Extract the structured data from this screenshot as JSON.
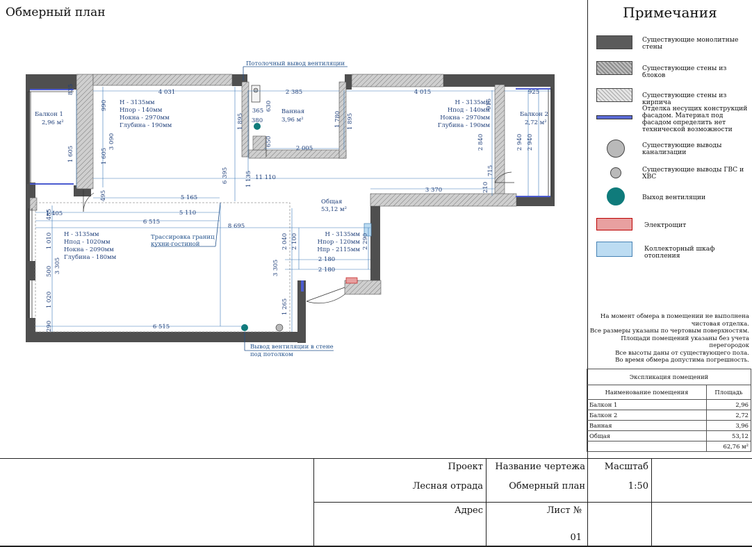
{
  "drawing_title": "Обмерный план",
  "notes": {
    "title": "Примечания",
    "legend": [
      {
        "icon": "monolith-wall-swatch",
        "label": "Существующие монолитные стены",
        "color": "#5b5b5b"
      },
      {
        "icon": "block-wall-swatch",
        "label": "Существующие стены из блоков",
        "color": "#9a9a9a"
      },
      {
        "icon": "brick-wall-swatch",
        "label": "Существующие стены из кирпича",
        "color": "#c8c8c8"
      },
      {
        "icon": "facade-finish-swatch",
        "label": "Отделка несущих конструкций фасадом. Материал под фасадом определить нет технической возможности",
        "color": "#5b6bd6"
      },
      {
        "icon": "sewer-outlet-circle",
        "label": "Существующие выводы канализации",
        "color": "#b9b9b9"
      },
      {
        "icon": "water-outlet-circle",
        "label": "Существующие выводы ГВС и ХВС",
        "color": "#b9b9b9"
      },
      {
        "icon": "ventilation-outlet-circle",
        "label": "Выход вентиляции",
        "color": "#0f7b7b"
      },
      {
        "icon": "electric-panel-swatch",
        "label": "Электрощит",
        "color": "#e8a0a0"
      },
      {
        "icon": "heating-cabinet-swatch",
        "label": "Коллекторный шкаф отопления",
        "color": "#bcdcf2"
      }
    ],
    "remarks": [
      "На момент обмера в помещении не выполнена",
      "чистовая отделка.",
      "Все размеры указаны по чертовым поверхностям.",
      "Площади помещений указаны без учета",
      "перегородок",
      "Все высоты даны от существующего пола.",
      "Во время обмера допустима погрешность."
    ]
  },
  "explication": {
    "title": "Экспликация помещений",
    "headers": [
      "Наименование помещения",
      "Площадь"
    ],
    "rows": [
      {
        "name": "Балкон 1",
        "area": "2,96"
      },
      {
        "name": "Балкон 2",
        "area": "2,72"
      },
      {
        "name": "Ванная",
        "area": "3,96"
      },
      {
        "name": "Общая",
        "area": "53,12"
      }
    ],
    "total": "62,76 м²"
  },
  "title_block": {
    "project_label": "Проект",
    "project_value": "Лесная отрада",
    "drawing_name_label": "Название чертежа",
    "drawing_name_value": "Обмерный план",
    "scale_label": "Масштаб",
    "scale_value": "1:50",
    "address_label": "Адрес",
    "sheet_label": "Лист №",
    "sheet_value": "01"
  },
  "plan": {
    "callouts": {
      "ceiling_vent": "Потолочный вывод вентиляции",
      "wall_vent_1": "Вывод вентиляции в стене",
      "wall_vent_2": "под потолком",
      "kitchen_1": "Трассировка границ",
      "kitchen_2": "кухни-гостиной"
    },
    "rooms": {
      "balcony1_name": "Балкон 1",
      "balcony1_area": "2,96 м²",
      "balcony2_name": "Балкон 2",
      "balcony2_area": "2,72 м²",
      "bath_name": "Ванная",
      "bath_area": "3,96 м²",
      "common_name": "Общая",
      "common_area": "53,12 м²"
    },
    "heights": {
      "room1": [
        "H - 3135мм",
        "Hпор - 140мм",
        "Hокна - 2970мм",
        "Глубина - 190мм"
      ],
      "room2": [
        "H - 3135мм",
        "Hпод - 140мм",
        "Hокна - 2970мм",
        "Глубина - 190мм"
      ],
      "room3": [
        "H - 3135мм",
        "Hпод - 1020мм",
        "Hокна - 2090мм",
        "Глубина - 180мм"
      ],
      "room4": [
        "H - 3135мм",
        "Hпор - 120мм",
        "Hпр - 2115мм"
      ]
    },
    "dimensions": {
      "d4031": "4 031",
      "d2385": "2 385",
      "d4015": "4 015",
      "d925": "925",
      "d990": "990",
      "d835": "835",
      "d1605a": "1 605",
      "d1605b": "1 605",
      "d3090": "3 090",
      "d495": "495",
      "d365": "365",
      "d630": "630",
      "d380": "380",
      "d650": "650",
      "d2005": "2 005",
      "d1895a": "1 895",
      "d1780": "1 780",
      "d1895b": "1 895",
      "d915": "915",
      "d2840": "2 840",
      "d715": "715",
      "d2940a": "2 940",
      "d2940b": "2 940",
      "d210": "210",
      "d6395": "6 395",
      "d1135": "1 135",
      "d11110": "11 110",
      "d3370": "3 370",
      "d5165": "5 165",
      "d1405": "1 405",
      "d5110": "5 110",
      "d485": "485",
      "d6515a": "6 515",
      "d8695": "8 695",
      "d1010": "1 010",
      "d500": "500",
      "d3305a": "3 305",
      "d1020": "1 020",
      "d290a": "290",
      "d6515b": "6 515",
      "d2040": "2 040",
      "d2100": "2 100",
      "d2290": "2 290",
      "d2180a": "2 180",
      "d2180b": "2 180",
      "d3305b": "3 305",
      "d1265": "1 265"
    }
  }
}
